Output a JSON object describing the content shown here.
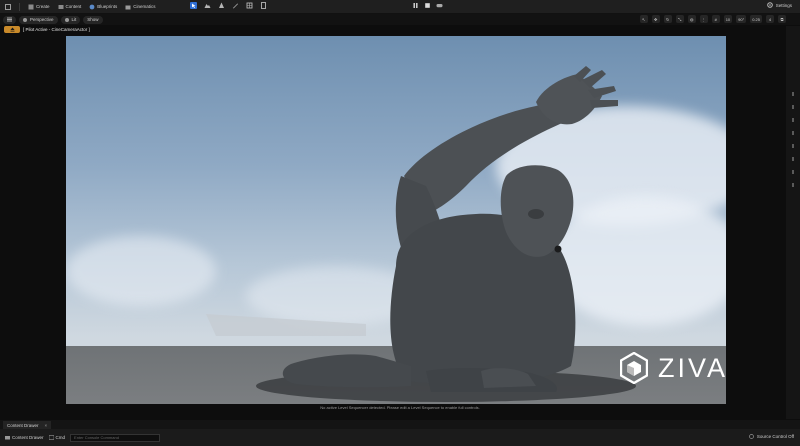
{
  "toolbar": {
    "create": "Create",
    "content": "Content",
    "blueprints": "Blueprints",
    "cinematics": "Cinematics",
    "settings": "Settings"
  },
  "viewport_toolbar": {
    "perspective": "Perspective",
    "lit": "Lit",
    "show": "Show",
    "fov": "90°",
    "snap": "0.25",
    "camera_speed": "4"
  },
  "pilot": {
    "label": "[ Pilot Active - CineCameraActor ]"
  },
  "viewport": {
    "message": "No active Level Sequencer detected. Please edit a Level Sequence to enable full controls."
  },
  "logo": {
    "text": "ZIVA"
  },
  "bottom": {
    "tab_label": "Content Drawer",
    "content_drawer": "Content Drawer",
    "cmd_label": "Cmd",
    "cmd_placeholder": "Enter Console Command",
    "source_control": "Source Control Off"
  },
  "colors": {
    "accent_orange": "#c98a2a",
    "sky_top": "#6e8fb0",
    "ground": "#74777a"
  }
}
